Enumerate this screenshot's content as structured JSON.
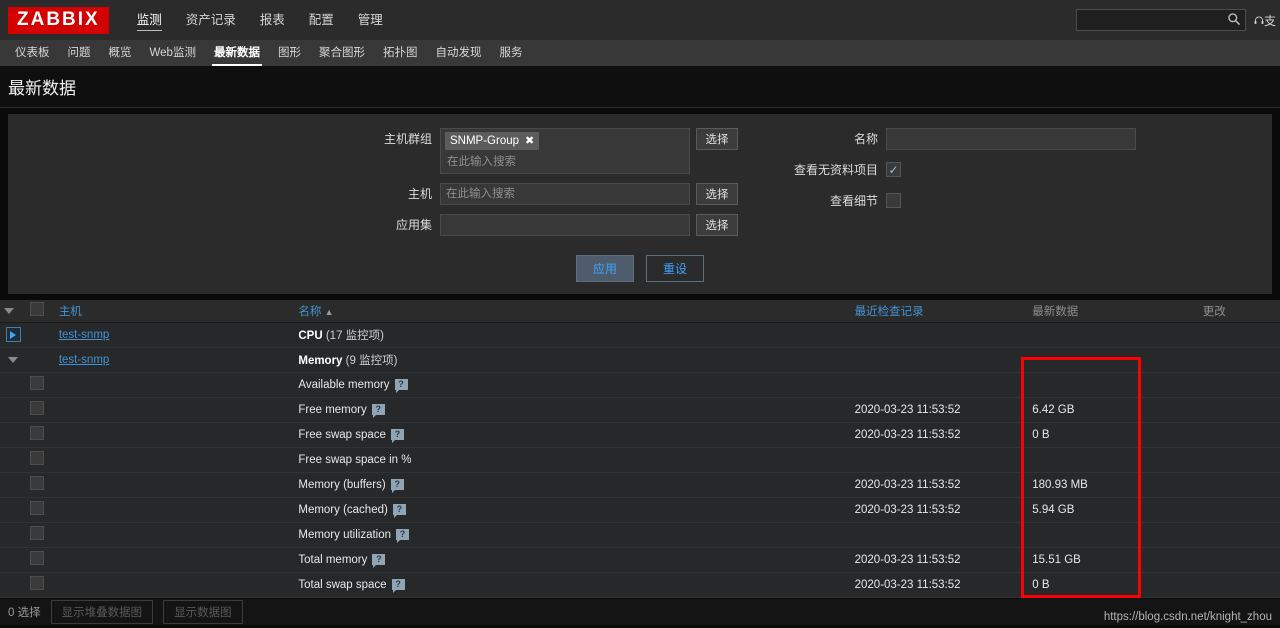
{
  "header": {
    "logo": "ZABBIX",
    "main_nav": [
      {
        "label": "监测",
        "active": true
      },
      {
        "label": "资产记录",
        "active": false
      },
      {
        "label": "报表",
        "active": false
      },
      {
        "label": "配置",
        "active": false
      },
      {
        "label": "管理",
        "active": false
      }
    ],
    "search": {
      "value": "",
      "placeholder": ""
    },
    "support_label": "支"
  },
  "subnav": [
    {
      "label": "仪表板",
      "active": false
    },
    {
      "label": "问题",
      "active": false
    },
    {
      "label": "概览",
      "active": false
    },
    {
      "label": "Web监测",
      "active": false
    },
    {
      "label": "最新数据",
      "active": true
    },
    {
      "label": "图形",
      "active": false
    },
    {
      "label": "聚合图形",
      "active": false
    },
    {
      "label": "拓扑图",
      "active": false
    },
    {
      "label": "自动发现",
      "active": false
    },
    {
      "label": "服务",
      "active": false
    }
  ],
  "page_title": "最新数据",
  "filter": {
    "hostgroup_label": "主机群组",
    "hostgroup_chips": [
      "SNMP-Group"
    ],
    "hostgroup_placeholder": "在此输入搜索",
    "host_label": "主机",
    "host_value": "",
    "host_placeholder": "在此输入搜索",
    "appset_label": "应用集",
    "appset_value": "",
    "appset_placeholder": "",
    "select_button": "选择",
    "name_label": "名称",
    "name_value": "",
    "name_placeholder": "",
    "show_without_data_label": "查看无资料项目",
    "show_without_data_checked": true,
    "show_details_label": "查看细节",
    "show_details_checked": false,
    "apply_button": "应用",
    "reset_button": "重设"
  },
  "table": {
    "headers": {
      "host": "主机",
      "name": "名称",
      "name_sort": "▲",
      "last_check": "最近检查记录",
      "last_value": "最新数据",
      "change": "更改"
    },
    "rows": [
      {
        "type": "group",
        "toggle": "collapsed",
        "host": "test-snmp",
        "name": "CPU",
        "count": "(17 监控项)",
        "last_check": "",
        "last_value": "",
        "change": ""
      },
      {
        "type": "group",
        "toggle": "expanded",
        "host": "test-snmp",
        "name": "Memory",
        "count": "(9 监控项)",
        "last_check": "",
        "last_value": "",
        "change": ""
      },
      {
        "type": "item",
        "name": "Available memory",
        "help": true,
        "last_check": "",
        "last_value": "",
        "change": ""
      },
      {
        "type": "item",
        "name": "Free memory",
        "help": true,
        "last_check": "2020-03-23 11:53:52",
        "last_value": "6.42 GB",
        "change": ""
      },
      {
        "type": "item",
        "name": "Free swap space",
        "help": true,
        "last_check": "2020-03-23 11:53:52",
        "last_value": "0 B",
        "change": ""
      },
      {
        "type": "item",
        "name": "Free swap space in %",
        "help": false,
        "last_check": "",
        "last_value": "",
        "change": ""
      },
      {
        "type": "item",
        "name": "Memory (buffers)",
        "help": true,
        "last_check": "2020-03-23 11:53:52",
        "last_value": "180.93 MB",
        "change": ""
      },
      {
        "type": "item",
        "name": "Memory (cached)",
        "help": true,
        "last_check": "2020-03-23 11:53:52",
        "last_value": "5.94 GB",
        "change": ""
      },
      {
        "type": "item",
        "name": "Memory utilization",
        "help": true,
        "last_check": "",
        "last_value": "",
        "change": ""
      },
      {
        "type": "item",
        "name": "Total memory",
        "help": true,
        "last_check": "2020-03-23 11:53:52",
        "last_value": "15.51 GB",
        "change": ""
      },
      {
        "type": "item",
        "name": "Total swap space",
        "help": true,
        "last_check": "2020-03-23 11:53:52",
        "last_value": "0 B",
        "change": ""
      }
    ]
  },
  "annotation": {
    "color": "#ff0000"
  },
  "footer": {
    "selection": "0 选择",
    "stacked_graph_button": "显示堆叠数据图",
    "graph_button": "显示数据图"
  },
  "watermark": "https://blog.csdn.net/knight_zhou"
}
